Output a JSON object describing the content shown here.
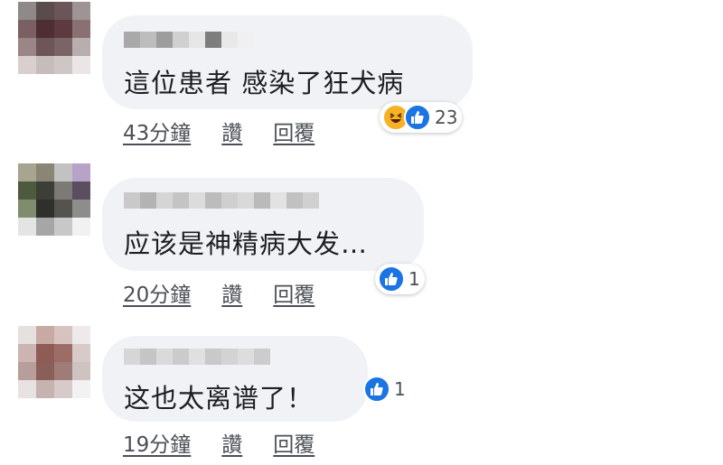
{
  "comments": [
    {
      "text": "這位患者 感染了狂犬病",
      "time": "43分鐘",
      "like": "讚",
      "reply": "回覆",
      "reaction_count": "23",
      "reactions": [
        "haha-icon",
        "like-icon"
      ]
    },
    {
      "text": "应该是神精病大发…",
      "time": "20分鐘",
      "like": "讚",
      "reply": "回覆",
      "reaction_count": "1",
      "reactions": [
        "like-icon"
      ]
    },
    {
      "text": "这也太离谱了！",
      "time": "19分鐘",
      "like": "讚",
      "reply": "回覆",
      "reaction_count": "1",
      "reactions": [
        "like-icon"
      ]
    }
  ],
  "colors": {
    "bubble": "#f0f2f5",
    "like": "#1b74e4",
    "haha": "#f7b125",
    "action_text": "#4b4f56"
  }
}
